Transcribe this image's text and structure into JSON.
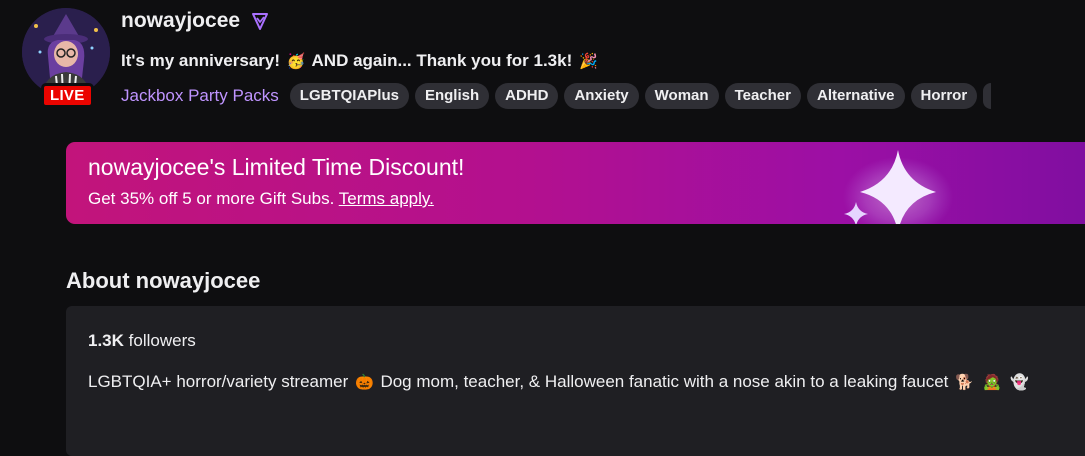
{
  "channel": {
    "name": "nowayjocee",
    "live_label": "LIVE",
    "partner_icon": "partner-badge-icon"
  },
  "stream": {
    "title_part1": "It's my anniversary!",
    "emoji1": "🥳",
    "title_part2": "AND again... Thank you for 1.3k!",
    "emoji2": "🎉",
    "category": "Jackbox Party Packs",
    "tags": [
      "LGBTQIAPlus",
      "English",
      "ADHD",
      "Anxiety",
      "Woman",
      "Teacher",
      "Alternative",
      "Horror"
    ]
  },
  "promo": {
    "title": "nowayjocee's Limited Time Discount!",
    "subtitle": "Get 35% off 5 or more Gift Subs.",
    "link": "Terms apply."
  },
  "about": {
    "heading": "About nowayjocee",
    "followers_count": "1.3K",
    "followers_label": "followers",
    "bio_text1": "LGBTQIA+ horror/variety streamer",
    "bio_emoji1": "🎃",
    "bio_text2": "Dog mom, teacher, & Halloween fanatic with a nose akin to a leaking faucet",
    "bio_emoji2": "🐕",
    "bio_emoji3": "🧟",
    "bio_emoji4": "👻"
  },
  "colors": {
    "background": "#0e0e10",
    "accent_purple": "#bf94ff",
    "live_red": "#eb0400",
    "tag_bg": "#2f2f35",
    "promo_gradient_start": "#c2147b",
    "promo_gradient_end": "#7f0ea0"
  }
}
